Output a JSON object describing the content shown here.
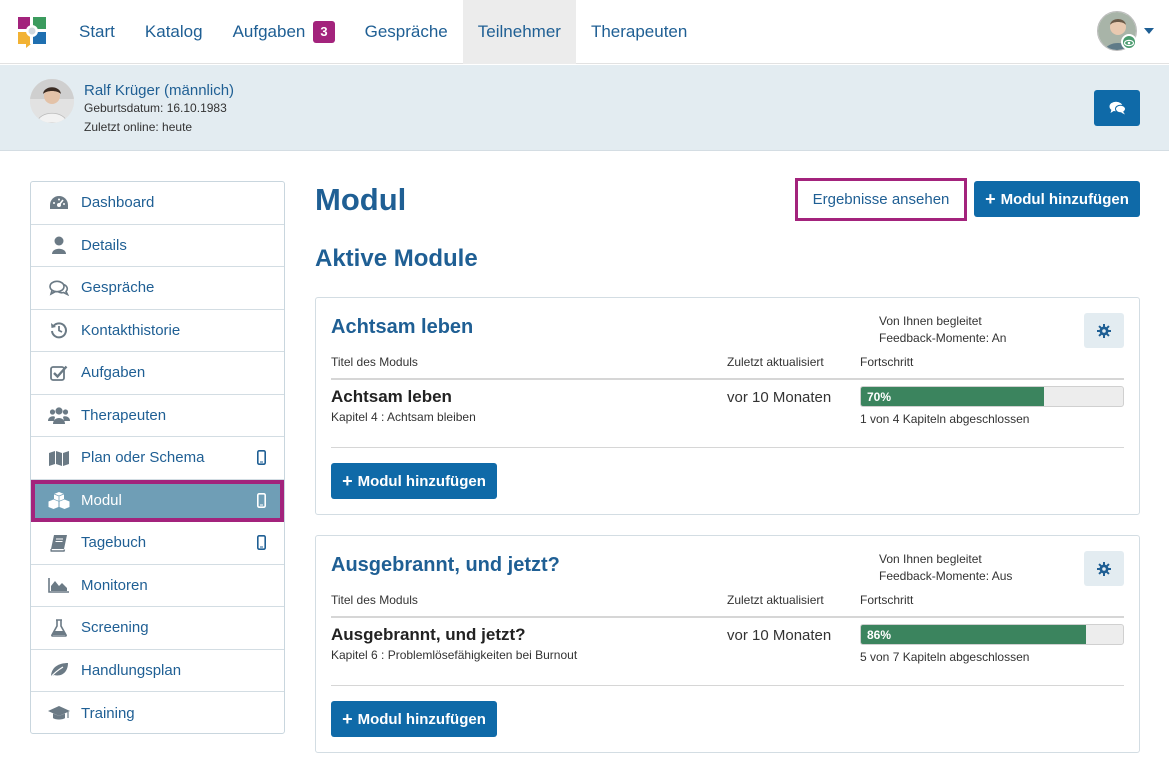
{
  "nav": {
    "items": [
      {
        "label": "Start",
        "badge": null
      },
      {
        "label": "Katalog",
        "badge": null
      },
      {
        "label": "Aufgaben",
        "badge": "3"
      },
      {
        "label": "Gespräche",
        "badge": null
      },
      {
        "label": "Teilnehmer",
        "badge": null,
        "active": true
      },
      {
        "label": "Therapeuten",
        "badge": null
      }
    ]
  },
  "patient": {
    "name": "Ralf Krüger (männlich)",
    "birth": "Geburtsdatum: 16.10.1983",
    "online": "Zuletzt online: heute"
  },
  "sidebar": {
    "items": [
      {
        "label": "Dashboard",
        "icon": "dashboard-icon"
      },
      {
        "label": "Details",
        "icon": "user-icon"
      },
      {
        "label": "Gespräche",
        "icon": "comments-icon"
      },
      {
        "label": "Kontakthistorie",
        "icon": "history-icon"
      },
      {
        "label": "Aufgaben",
        "icon": "checkbox-icon"
      },
      {
        "label": "Therapeuten",
        "icon": "users-icon"
      },
      {
        "label": "Plan oder Schema",
        "icon": "map-icon",
        "mobile": true
      },
      {
        "label": "Modul",
        "icon": "cubes-icon",
        "mobile": true,
        "active": true
      },
      {
        "label": "Tagebuch",
        "icon": "book-icon",
        "mobile": true
      },
      {
        "label": "Monitoren",
        "icon": "area-chart-icon"
      },
      {
        "label": "Screening",
        "icon": "flask-icon"
      },
      {
        "label": "Handlungsplan",
        "icon": "leaf-icon"
      },
      {
        "label": "Training",
        "icon": "graduation-cap-icon"
      }
    ]
  },
  "main": {
    "title": "Modul",
    "results_label": "Ergebnisse ansehen",
    "add_module_label": "Modul hinzufügen",
    "section_title": "Aktive Module",
    "columns": {
      "title": "Titel des Moduls",
      "updated": "Zuletzt aktualisiert",
      "progress": "Fortschritt"
    },
    "cards": [
      {
        "title": "Achtsam leben",
        "guided": "Von Ihnen begleitet",
        "feedback": "Feedback-Momente: An",
        "module_name": "Achtsam leben",
        "chapter": "Kapitel 4 : Achtsam bleiben",
        "updated": "vor 10 Monaten",
        "progress_label": "70%",
        "progress_value": 70,
        "progress_text": "1 von 4 Kapiteln abgeschlossen",
        "add_label": "Modul hinzufügen"
      },
      {
        "title": "Ausgebrannt, und jetzt?",
        "guided": "Von Ihnen begleitet",
        "feedback": "Feedback-Momente: Aus",
        "module_name": "Ausgebrannt, und jetzt?",
        "chapter": "Kapitel 6 : Problemlösefähigkeiten bei Burnout",
        "updated": "vor 10 Monaten",
        "progress_label": "86%",
        "progress_value": 86,
        "progress_text": "5 von 7 Kapiteln abgeschlossen",
        "add_label": "Modul hinzufügen"
      }
    ]
  },
  "colors": {
    "primary": "#0f6aa8",
    "link": "#1f5f94",
    "highlight": "#a3237c",
    "progress": "#3b845e",
    "sidebar_active": "#6f9eb6"
  }
}
